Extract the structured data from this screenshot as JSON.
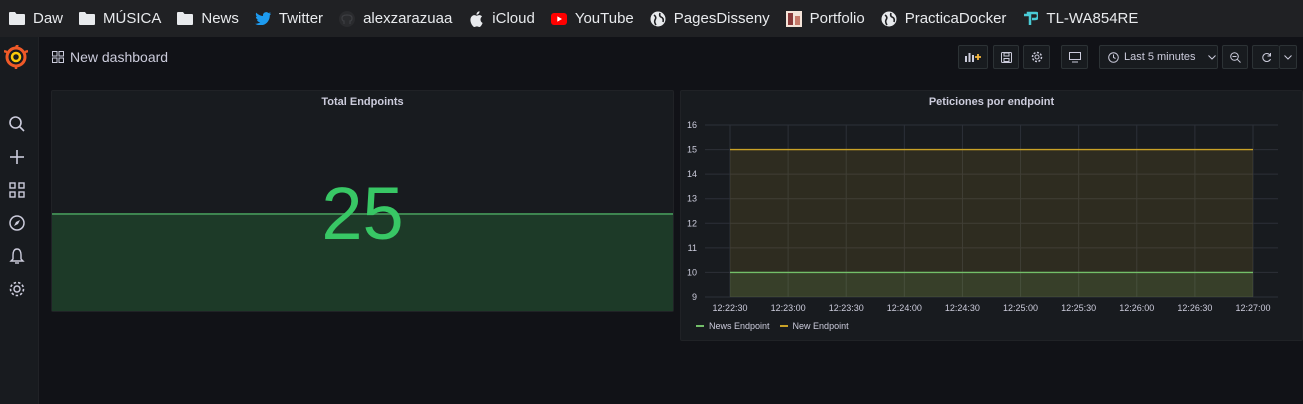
{
  "bookmarks": [
    {
      "label": "Daw",
      "icon": "folder-icon"
    },
    {
      "label": "MÚSICA",
      "icon": "folder-icon"
    },
    {
      "label": "News",
      "icon": "folder-icon"
    },
    {
      "label": "Twitter",
      "icon": "twitter-icon"
    },
    {
      "label": "alexzarazuaa",
      "icon": "github-icon"
    },
    {
      "label": "iCloud",
      "icon": "apple-icon"
    },
    {
      "label": "YouTube",
      "icon": "youtube-icon"
    },
    {
      "label": "PagesDisseny",
      "icon": "globe-icon"
    },
    {
      "label": "Portfolio",
      "icon": "portfolio-icon"
    },
    {
      "label": "PracticaDocker",
      "icon": "globe-icon"
    },
    {
      "label": "TL-WA854RE",
      "icon": "tplink-icon"
    }
  ],
  "dashboard": {
    "title": "New dashboard",
    "time_range": "Last 5 minutes"
  },
  "panels": {
    "stat": {
      "title": "Total Endpoints",
      "value": "25",
      "color": "#38c765"
    },
    "graph": {
      "title": "Peticiones por endpoint"
    }
  },
  "chart_data": {
    "type": "line",
    "title": "Peticiones por endpoint",
    "x": [
      "12:22:30",
      "12:23:00",
      "12:23:30",
      "12:24:00",
      "12:24:30",
      "12:25:00",
      "12:25:30",
      "12:26:00",
      "12:26:30",
      "12:27:00"
    ],
    "yticks": [
      9,
      10,
      11,
      12,
      13,
      14,
      15,
      16
    ],
    "ylim": [
      9,
      16
    ],
    "grid": true,
    "legend_position": "bottom-left",
    "series": [
      {
        "name": "News Endpoint",
        "color": "#73bf69",
        "values": [
          10,
          10,
          10,
          10,
          10,
          10,
          10,
          10,
          10,
          10
        ]
      },
      {
        "name": "New Endpoint",
        "color": "#c9a227",
        "values": [
          15,
          15,
          15,
          15,
          15,
          15,
          15,
          15,
          15,
          15
        ]
      }
    ]
  },
  "colors": {
    "background": "#111217",
    "panel": "#181b1f",
    "bookmark_bar": "#202124"
  }
}
